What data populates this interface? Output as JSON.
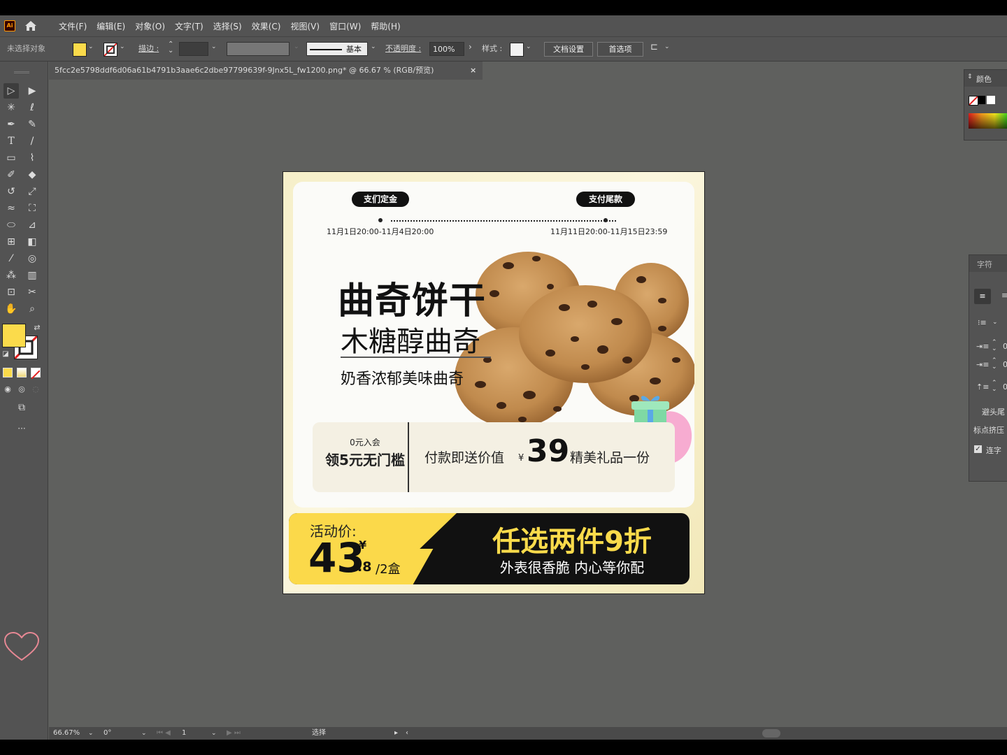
{
  "app": {
    "logo": "Ai"
  },
  "menu": [
    "文件(F)",
    "编辑(E)",
    "对象(O)",
    "文字(T)",
    "选择(S)",
    "效果(C)",
    "视图(V)",
    "窗口(W)",
    "帮助(H)"
  ],
  "control_bar": {
    "selection_status": "未选择对象",
    "stroke_label": "描边 :",
    "brush_label": "基本",
    "opacity_label": "不透明度 :",
    "opacity_value": "100%",
    "style_label": "样式 :",
    "doc_setup": "文档设置",
    "preferences": "首选项"
  },
  "document_tab": {
    "title": "5fcc2e5798ddf6d06a61b4791b3aae6c2dbe97799639f-9Jnx5L_fw1200.png* @ 66.67 % (RGB/预览)",
    "close": "×"
  },
  "colors": {
    "fill": "#fbdb4b",
    "ui_bg": "#535353",
    "canvas": "#5f605e"
  },
  "panels": {
    "color": {
      "title": "颜色"
    },
    "character": {
      "title": "字符",
      "kinsoku_label": "避头尾",
      "mojikumi_label": "标点挤压",
      "ligature_label": "连字",
      "indent_values": [
        "0",
        "0",
        "0"
      ]
    }
  },
  "statusbar": {
    "zoom": "66.67%",
    "rotation": "0°",
    "artboard": "1",
    "tool": "选择"
  },
  "artwork": {
    "deposit_pill": "支们定金",
    "balance_pill": "支付尾款",
    "deposit_date": "11月1日20:00-11月4日20:00",
    "balance_date": "11月11日20:00-11月15日23:59",
    "title": "曲奇饼干",
    "subtitle": "木糖醇曲奇",
    "tagline": "奶香浓郁美味曲奇",
    "join_small": "0元入会",
    "join_big": "领5元无门槛",
    "gift_prefix": "付款即送价值",
    "yen": "¥",
    "gift_value": "39",
    "gift_suffix": "精美礼品一份",
    "price_label": "活动价:",
    "price_int": "43",
    "price_currency": "¥",
    "price_dec": ".8",
    "price_unit": "/2盒",
    "offer_title": "任选两件9折",
    "offer_sub": "外表很香脆 内心等你配"
  }
}
